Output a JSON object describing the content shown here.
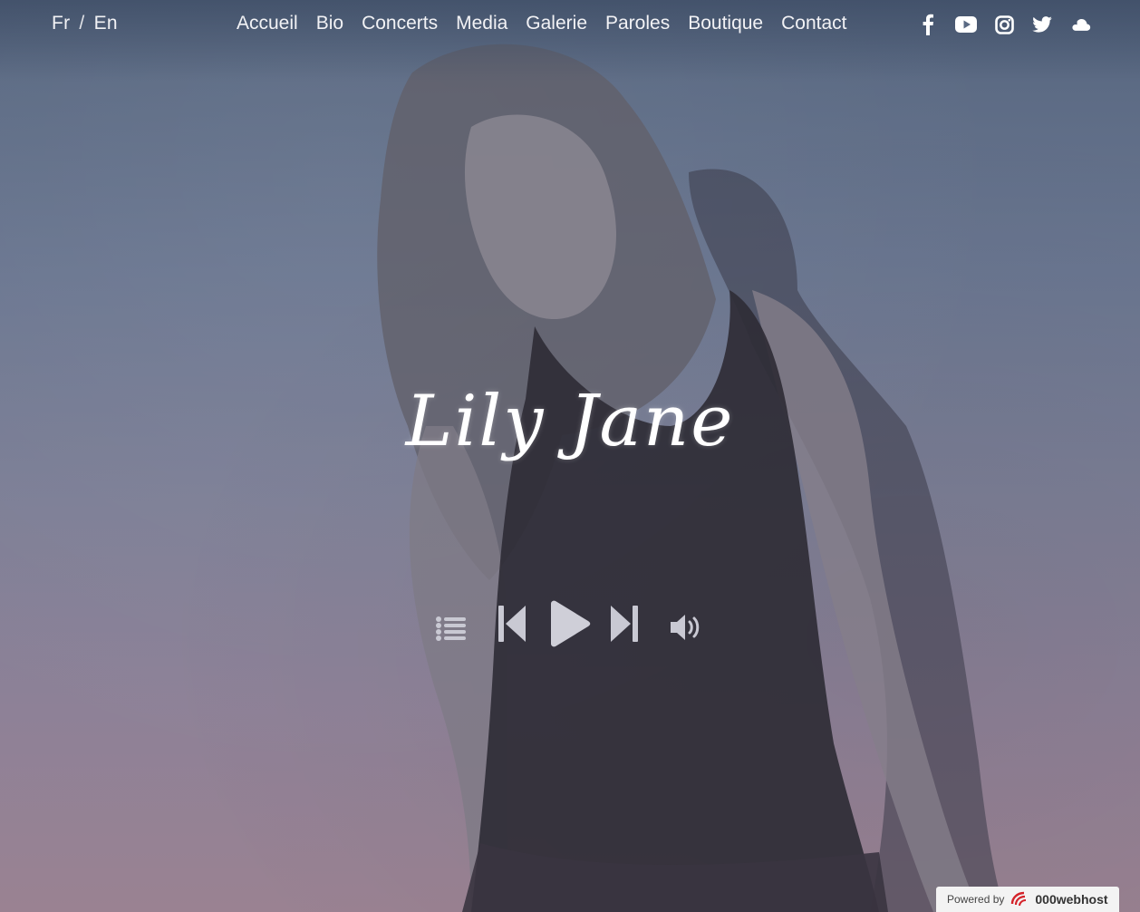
{
  "language": {
    "fr": "Fr",
    "separator": "/",
    "en": "En"
  },
  "nav": {
    "items": [
      "Accueil",
      "Bio",
      "Concerts",
      "Media",
      "Galerie",
      "Paroles",
      "Boutique",
      "Contact"
    ]
  },
  "social": {
    "icons": [
      "facebook-icon",
      "youtube-icon",
      "instagram-icon",
      "twitter-icon",
      "soundcloud-icon"
    ]
  },
  "hero": {
    "title": "Lily Jane"
  },
  "player": {
    "icons": [
      "playlist-icon",
      "previous-icon",
      "play-icon",
      "next-icon",
      "volume-icon"
    ]
  },
  "footer_badge": {
    "prefix": "Powered by",
    "brand": "000webhost"
  },
  "colors": {
    "text": "#f2f2f5",
    "background_top": "#56667f",
    "background_bottom": "#9a8292"
  }
}
